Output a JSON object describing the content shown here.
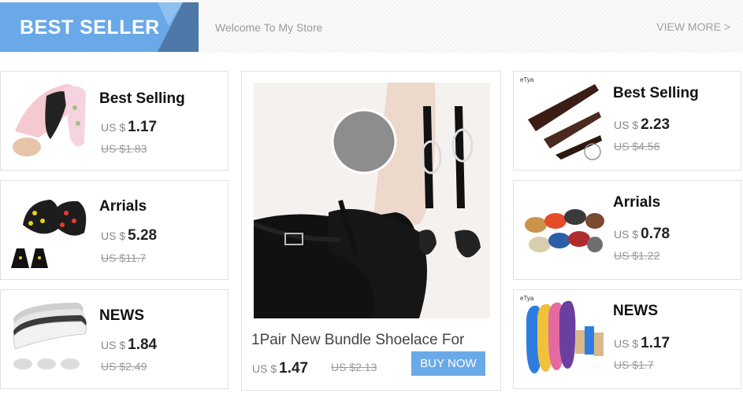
{
  "header": {
    "badge": "BEST SELLER",
    "welcome": "Welcome To My Store",
    "view_more": "VIEW MORE >"
  },
  "colors": {
    "accent": "#6aa9e8",
    "badge_dark": "#4d78a8"
  },
  "left_products": [
    {
      "title": "Best Selling",
      "currency": "US $",
      "price": "1.17",
      "old_price": "US $1.83",
      "icon": "insole-pads-icon"
    },
    {
      "title": "Arrials",
      "currency": "US $",
      "price": "5.28",
      "old_price": "US $11.7",
      "icon": "ice-cleats-icon"
    },
    {
      "title": "NEWS",
      "currency": "US $",
      "price": "1.84",
      "old_price": "US $2.49",
      "icon": "height-insole-icon"
    }
  ],
  "right_products": [
    {
      "title": "Best Selling",
      "currency": "US $",
      "price": "2.23",
      "old_price": "US $4.56",
      "icon": "shoe-horn-icon",
      "brand": "eTya"
    },
    {
      "title": "Arrials",
      "currency": "US $",
      "price": "0.78",
      "old_price": "US $1.22",
      "icon": "shoelace-icon"
    },
    {
      "title": "NEWS",
      "currency": "US $",
      "price": "1.17",
      "old_price": "US $1.7",
      "icon": "colored-insoles-icon",
      "brand": "eTya"
    }
  ],
  "feature": {
    "title": "1Pair New Bundle Shoelace For",
    "currency": "US $",
    "price": "1.47",
    "old_price": "US $2.13",
    "buy_label": "BUY NOW",
    "icon": "ankle-strap-heel-icon"
  }
}
